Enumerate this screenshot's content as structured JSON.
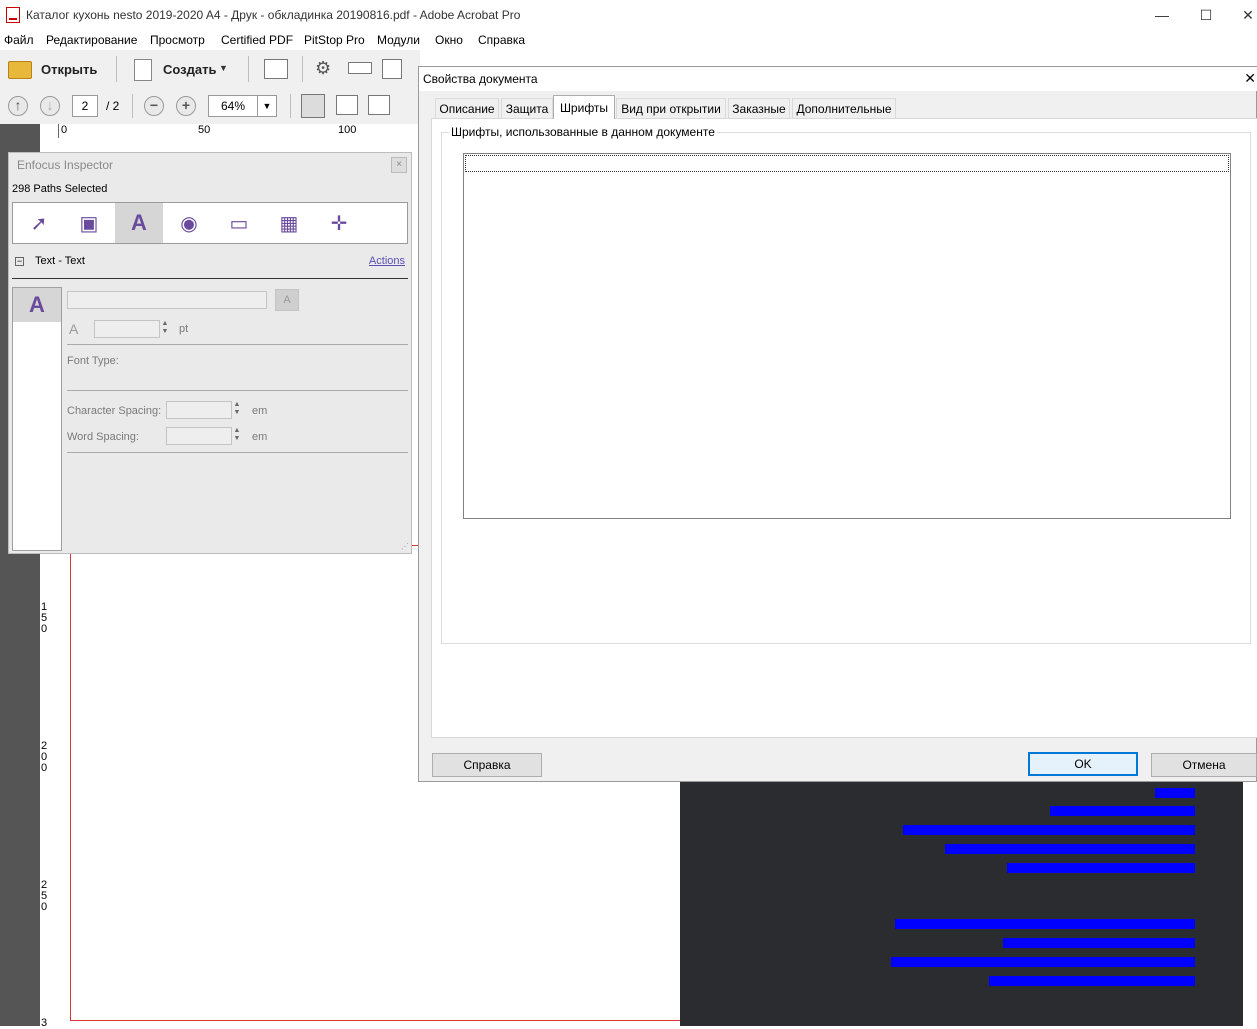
{
  "window": {
    "title": "Каталог кухонь nesto 2019-2020 A4 - Друк - обкладинка 20190816.pdf - Adobe Acrobat Pro"
  },
  "menu": [
    "Файл",
    "Редактирование",
    "Просмотр",
    "Certified PDF",
    "PitStop Pro",
    "Модули",
    "Окно",
    "Справка"
  ],
  "toolbar": {
    "open_label": "Открыть",
    "create_label": "Создать",
    "page_current": "2",
    "page_total": "/ 2",
    "zoom": "64%"
  },
  "rulers": {
    "h_ticks": [
      "0",
      "50",
      "100"
    ],
    "v_ticks": [
      "1\n5\n0",
      "2\n0\n0",
      "2\n5\n0",
      "3"
    ]
  },
  "inspector": {
    "title": "Enfocus Inspector",
    "selection": "298 Paths Selected",
    "section": "Text - Text",
    "actions": "Actions",
    "unit_pt": "pt",
    "font_type_label": "Font Type:",
    "char_spacing_label": "Character Spacing:",
    "word_spacing_label": "Word Spacing:",
    "unit_em": "em",
    "icons": [
      "select-icon",
      "transform-icon",
      "text-icon",
      "camera-icon",
      "monitor-icon",
      "color-icon",
      "position-icon"
    ]
  },
  "dialog": {
    "title": "Свойства документа",
    "tabs": [
      "Описание",
      "Защита",
      "Шрифты",
      "Вид при открытии",
      "Заказные",
      "Дополнительные"
    ],
    "active_tab": "Шрифты",
    "group_label": "Шрифты, использованные в данном документе",
    "help_button": "Справка",
    "ok_button": "OK",
    "cancel_button": "Отмена"
  },
  "colors": {
    "accent": "#0078d7",
    "dark_panel": "#2b2c30",
    "page_trim": "#dd3333",
    "inspector_accent": "#6a4a9c"
  }
}
